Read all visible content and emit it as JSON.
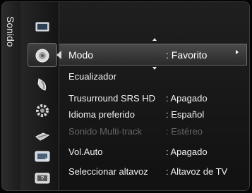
{
  "section_title": "Sonido",
  "icons": [
    {
      "name": "picture-menu-icon"
    },
    {
      "name": "sound-menu-icon"
    },
    {
      "name": "channel-menu-icon"
    },
    {
      "name": "setup-menu-icon"
    },
    {
      "name": "input-menu-icon"
    },
    {
      "name": "application-menu-icon"
    },
    {
      "name": "support-menu-icon"
    }
  ],
  "menu": {
    "selected_index": 0,
    "items": [
      {
        "label": "Modo",
        "value": ": Favorito",
        "enabled": true
      },
      {
        "label": "Ecualizador",
        "value": "",
        "enabled": true
      },
      {
        "label": "Trusurround SRS HD",
        "value": ": Apagado",
        "enabled": true
      },
      {
        "label": "Idioma preferido",
        "value": ": Español",
        "enabled": true
      },
      {
        "label": "Sonido Multi-track",
        "value": ": Estéreo",
        "enabled": false
      },
      {
        "label": "Vol.Auto",
        "value": ": Apagado",
        "enabled": true
      },
      {
        "label": "Seleccionar altavoz",
        "value": ": Altavoz de TV",
        "enabled": true
      }
    ]
  }
}
